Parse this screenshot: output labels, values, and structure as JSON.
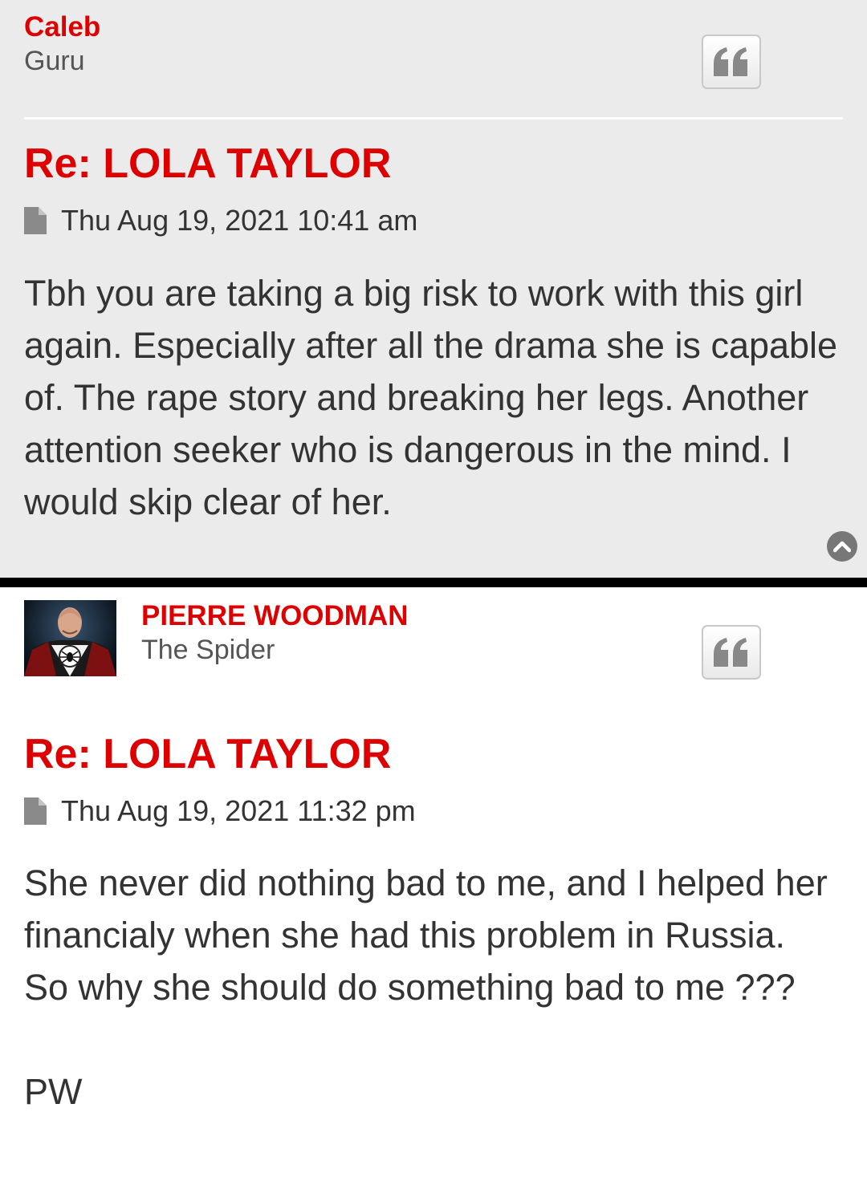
{
  "post1": {
    "username": "Caleb",
    "rank": "Guru",
    "title": "Re: LOLA TAYLOR",
    "date": "Thu Aug 19, 2021 10:41 am",
    "body": [
      "Tbh you are taking a big risk to work with this girl again. Especially after all the drama she is capable of. The rape story and breaking her legs. Another attention seeker who is dangerous in the mind. I would skip clear of her."
    ],
    "quote_icon": "quote-icon"
  },
  "post2": {
    "username": "PIERRE WOODMAN",
    "rank": "The Spider",
    "title": "Re: LOLA TAYLOR",
    "date": "Thu Aug 19, 2021 11:32 pm",
    "body": [
      "She never did nothing bad to me, and I helped her financialy when she had this problem in Russia.",
      "So why she should do something bad to me ???",
      "",
      "PW"
    ],
    "quote_icon": "quote-icon"
  },
  "icons": {
    "post_meta": "file-icon",
    "scroll": "chevron-up-icon"
  },
  "colors": {
    "accent": "#dd0000",
    "post_alt_bg": "#ebebeb",
    "text": "#333333",
    "rank": "#555555"
  }
}
